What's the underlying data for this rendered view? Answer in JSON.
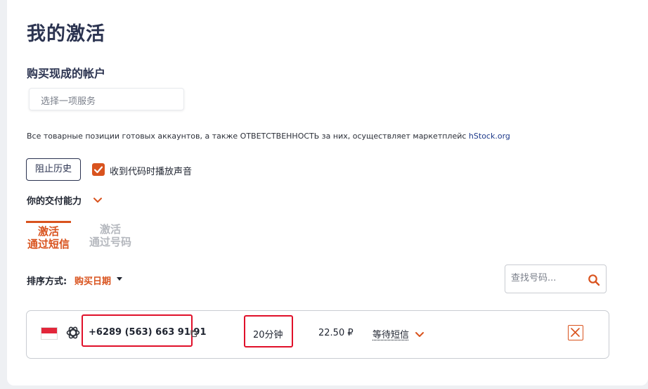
{
  "header": {
    "title": "我的激活"
  },
  "buy_section": {
    "title": "购买现成的帐户",
    "service_placeholder": "选择一项服务",
    "notice": "Все товарные позиции готовых аккаунтов, а также ОТВЕТСТВЕННОСТЬ за них, осуществляет маркетплейс ",
    "notice_link": "hStock.org"
  },
  "controls": {
    "block_history_label": "阻止历史",
    "sound_checkbox": {
      "label": "收到代码时播放声音",
      "checked": true
    },
    "delivery_label": "你的交付能力"
  },
  "tabs": [
    {
      "line1": "激活",
      "line2": "通过短信",
      "active": true
    },
    {
      "line1": "激活",
      "line2": "通过号码",
      "active": false
    }
  ],
  "sort": {
    "label": "排序方式:",
    "value": "购买日期"
  },
  "search": {
    "placeholder": "查找号码..."
  },
  "activations": [
    {
      "country_flag": "indonesia-flag",
      "service_icon": "openai-icon",
      "phone": "+6289 (563) 663 91 91",
      "time": "20分钟",
      "price": "22.50 ₽",
      "status": "等待短信"
    }
  ],
  "colors": {
    "accent": "#d9531e",
    "title": "#2b3350",
    "highlight": "#e0102a"
  }
}
